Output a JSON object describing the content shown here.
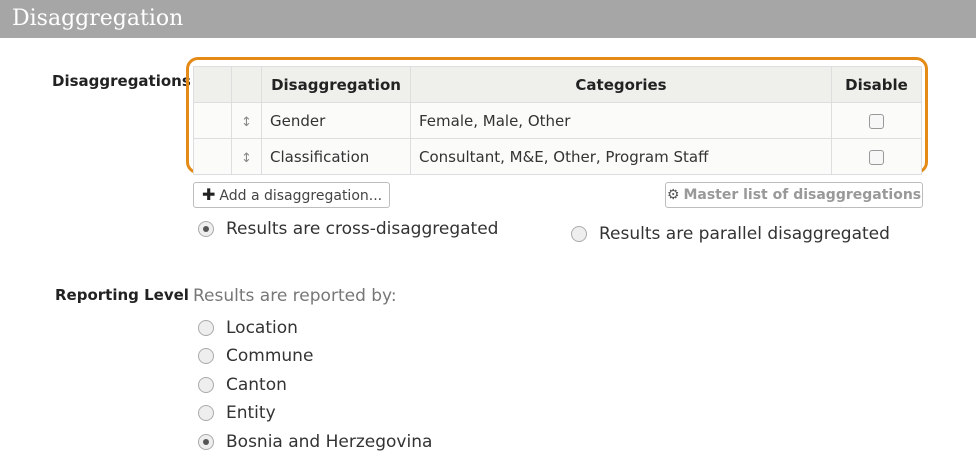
{
  "header": {
    "title": "Disaggregation"
  },
  "disaggregations": {
    "label": "Disaggregations",
    "columns": {
      "disaggregation": "Disaggregation",
      "categories": "Categories",
      "disable": "Disable"
    },
    "rows": [
      {
        "name": "Gender",
        "categories": "Female, Male, Other",
        "disabled": false
      },
      {
        "name": "Classification",
        "categories": "Consultant, M&E, Other, Program Staff",
        "disabled": false
      }
    ],
    "add_button": "Add a disaggregation...",
    "master_button": "Master list of disaggregations",
    "mode_options": {
      "cross": "Results are cross-disaggregated",
      "parallel": "Results are parallel disaggregated"
    },
    "selected_mode": "cross"
  },
  "reporting": {
    "label": "Reporting Level",
    "prompt": "Results are reported by:",
    "options": [
      "Location",
      "Commune",
      "Canton",
      "Entity",
      "Bosnia and Herzegovina"
    ],
    "selected": "Bosnia and Herzegovina"
  }
}
